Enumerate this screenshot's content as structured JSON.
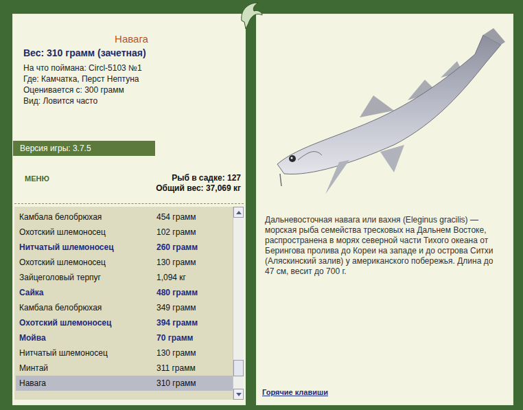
{
  "fish": {
    "title": "Навага",
    "weight": "Вес: 310 грамм (зачетная)",
    "details": [
      "На что поймана: Circl-5103 №1",
      "Где: Камчатка, Перст Нептуна",
      "Оценивается с: 300 грамм",
      "Вид: Ловится часто"
    ]
  },
  "version": "Версия игры: 3.7.5",
  "menu": "МЕНЮ",
  "stats": [
    "Рыб в садке: 127",
    "Общий вес: 37,069 кг"
  ],
  "catch_list": {
    "scroll_level": 0.92,
    "rows": [
      {
        "name": "Камбала белобрюхая",
        "weight": "454 грамм",
        "highlighted": false,
        "selected": false
      },
      {
        "name": "Охотский шлемоносец",
        "weight": "102 грамм",
        "highlighted": false,
        "selected": false
      },
      {
        "name": "Нитчатый шлемоносец",
        "weight": "260 грамм",
        "highlighted": true,
        "selected": false
      },
      {
        "name": "Охотский шлемоносец",
        "weight": "130 грамм",
        "highlighted": false,
        "selected": false
      },
      {
        "name": "Зайцеголовый терпуг",
        "weight": "1,094 кг",
        "highlighted": false,
        "selected": false
      },
      {
        "name": "Сайка",
        "weight": "480 грамм",
        "highlighted": true,
        "selected": false
      },
      {
        "name": "Камбала белобрюхая",
        "weight": "349 грамм",
        "highlighted": false,
        "selected": false
      },
      {
        "name": "Охотский шлемоносец",
        "weight": "394 грамм",
        "highlighted": true,
        "selected": false
      },
      {
        "name": "Мойва",
        "weight": "70 грамм",
        "highlighted": true,
        "selected": false
      },
      {
        "name": "Нитчатый шлемоносец",
        "weight": "130 грамм",
        "highlighted": false,
        "selected": false
      },
      {
        "name": "Минтай",
        "weight": "311 грамм",
        "highlighted": false,
        "selected": false
      },
      {
        "name": "Навага",
        "weight": "310 грамм",
        "highlighted": false,
        "selected": true
      }
    ]
  },
  "description": "Дальневосточная навага или вахня (Eleginus gracilis) — морская рыба семейства тресковых на Дальнем Востоке, распространена в морях северной части Тихого океана от Берингова пролива до Кореи на западе и до острова Ситхи (Аляскинский залив) у американского побережья. Длина до 47 см, весит до 700 г.",
  "hotkeys_link": "Горячие клавиши"
}
